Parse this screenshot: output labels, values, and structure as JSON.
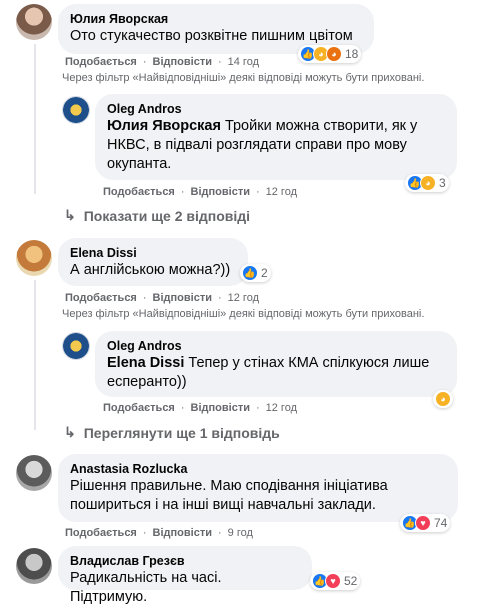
{
  "comments": [
    {
      "author": "Юлия Яворская",
      "text": "Ото стукачество розквітне пишним цвітом",
      "like_label": "Подобається",
      "reply_label": "Відповісти",
      "time": "14 год",
      "reaction_count": "18",
      "reaction_icons": [
        "like-icon",
        "sad-icon",
        "angry-icon"
      ],
      "filter_notice": "Через фільтр «Найвідповідніші» деякі відповіді можуть бути приховані.",
      "reply": {
        "author": "Oleg Andros",
        "mention": "Юлия Яворская",
        "text": " Тройки можна створити, як у НКВС, в підвалі розглядати справи про мову окупанта.",
        "like_label": "Подобається",
        "reply_label": "Відповісти",
        "time": "12 год",
        "reaction_count": "3",
        "reaction_icons": [
          "like-icon",
          "sad-icon"
        ]
      },
      "more_replies": "Показати ще 2 відповіді"
    },
    {
      "author": "Elena Dissi",
      "text": "А англійською можна?))",
      "like_label": "Подобається",
      "reply_label": "Відповісти",
      "time": "12 год",
      "reaction_count": "2",
      "reaction_icons": [
        "like-icon"
      ],
      "filter_notice": "Через фільтр «Найвідповідніші» деякі відповіді можуть бути приховані.",
      "reply": {
        "author": "Oleg Andros",
        "mention": "Elena Dissi",
        "text": " Тепер у стінах КМА спілкуюся лише есперанто))",
        "like_label": "Подобається",
        "reply_label": "Відповісти",
        "time": "12 год",
        "reaction_icons": [
          "haha-icon"
        ]
      },
      "more_replies": "Переглянути ще 1 відповідь"
    },
    {
      "author": "Anastasia Rozlucka",
      "text": "Рішення правильне. Маю сподівання ініціатива пошириться і на інші вищі навчальні заклади.",
      "like_label": "Подобається",
      "reply_label": "Відповісти",
      "time": "9 год",
      "reaction_count": "74",
      "reaction_icons": [
        "like-icon",
        "love-icon"
      ]
    },
    {
      "author": "Владислав Грезєв",
      "text": "Радикальність на часі. Підтримую.",
      "reaction_count": "52",
      "reaction_icons": [
        "like-icon",
        "love-icon"
      ]
    }
  ],
  "colors": {
    "bubble": "#f0f2f5",
    "secondary_text": "#65676b",
    "like_blue": "#1877f2",
    "love_red": "#f33e58",
    "emoji_yellow": "#f7b125"
  }
}
